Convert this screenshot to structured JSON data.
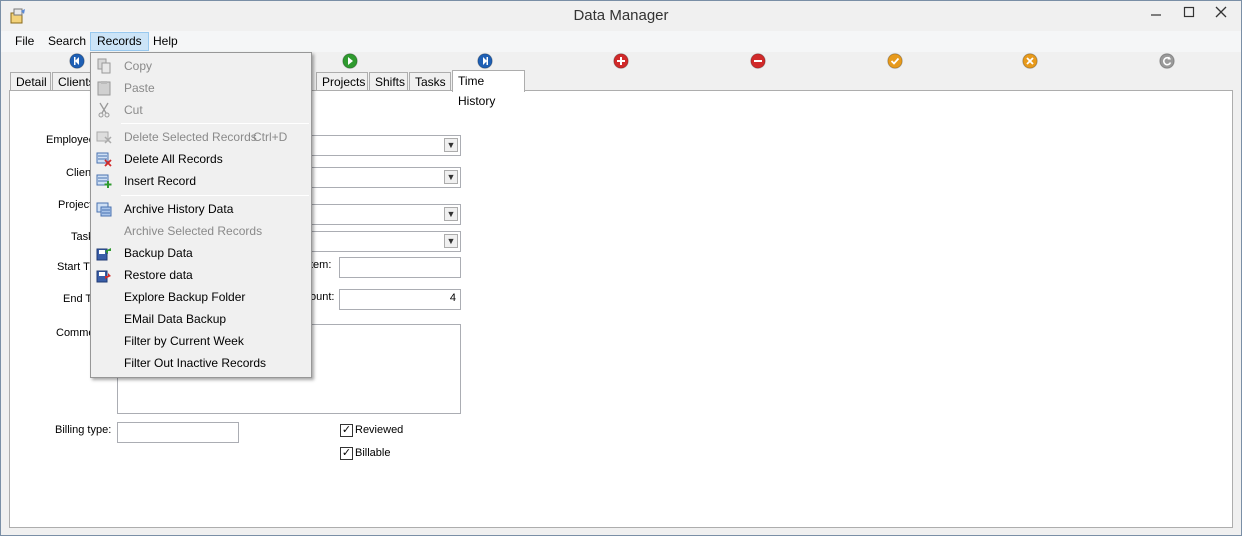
{
  "window": {
    "title": "Data Manager"
  },
  "menubar": {
    "file": "File",
    "search": "Search",
    "records": "Records",
    "help": "Help"
  },
  "tabs": [
    "Detail",
    "Clients",
    "Projects",
    "Shifts",
    "Tasks",
    "Time History"
  ],
  "active_tab": "Time History",
  "toolbar_icons": [
    {
      "name": "first-record-icon",
      "color": "#1e5fb4"
    },
    {
      "name": "next-record-icon",
      "color": "#2f9a2f"
    },
    {
      "name": "last-record-icon",
      "color": "#1e5fb4"
    },
    {
      "name": "add-record-icon",
      "color": "#d12a2a"
    },
    {
      "name": "delete-record-icon",
      "color": "#d12a2a"
    },
    {
      "name": "post-edit-icon",
      "color": "#e79a1c"
    },
    {
      "name": "cancel-edit-icon",
      "color": "#e79a1c"
    },
    {
      "name": "refresh-icon",
      "color": "#9a9a9a"
    }
  ],
  "form": {
    "employee_label": "Employee",
    "client_label": "Client",
    "project_label": "Project",
    "task_label": "Task",
    "start_label": "Start T",
    "end_label": "End T",
    "comment_label": "Comme",
    "item_label": "tem:",
    "amount_label": "ount:",
    "amount_value": "4",
    "billing_type_label": "Billing type:",
    "reviewed_label": "Reviewed",
    "reviewed_checked": true,
    "billable_label": "Billable",
    "billable_checked": true
  },
  "records_menu": {
    "copy": "Copy",
    "paste": "Paste",
    "cut": "Cut",
    "delete_selected": "Delete Selected Records",
    "delete_selected_shortcut": "Ctrl+D",
    "delete_all": "Delete All Records",
    "insert": "Insert Record",
    "archive_history": "Archive History Data",
    "archive_selected": "Archive Selected Records",
    "backup": "Backup Data",
    "restore": "Restore data",
    "explore_backup": "Explore Backup Folder",
    "email_backup": "EMail Data Backup",
    "filter_week": "Filter by Current Week",
    "filter_inactive": "Filter Out Inactive Records"
  },
  "colors": {
    "menu_highlight": "#cce4f7",
    "accent_blue": "#1e5fb4"
  }
}
